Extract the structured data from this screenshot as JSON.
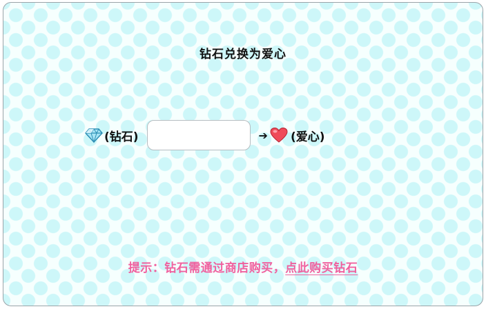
{
  "dialog": {
    "title": "钻石兑换为爱心",
    "diamond_label": "(钻石)",
    "diamond_input_value": "",
    "arrow": "➔",
    "heart_label": "(爱心)",
    "hint_text": "提示：钻石需通过商店购买，",
    "hint_link": "点此购买钻石",
    "colors": {
      "hint": "#f0609e",
      "pattern": "#cdf7f9",
      "gem": "#6ecbe8",
      "heart": "#e83a4a"
    }
  }
}
